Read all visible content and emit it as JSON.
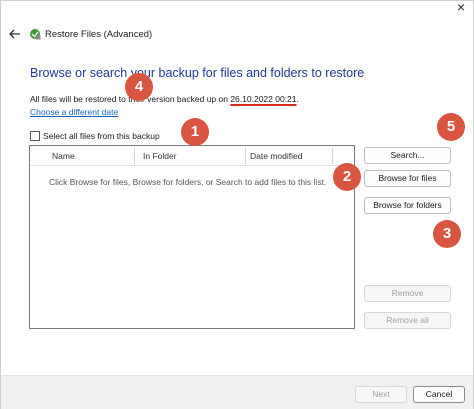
{
  "window": {
    "title": "Restore Files (Advanced)"
  },
  "heading": "Browse or search your backup for files and folders to restore",
  "restore_info": {
    "prefix": "All files will be restored to their version backed up on ",
    "date": "26.10.2022 00:21",
    "suffix": "."
  },
  "choose_link": "Choose a different date",
  "select_all_label": "Select all files from this backup",
  "select_all_checked": false,
  "grid": {
    "columns": [
      "Name",
      "In Folder",
      "Date modified"
    ],
    "empty_hint": "Click Browse for files, Browse for folders, or Search to add files to this list."
  },
  "buttons": {
    "search": "Search...",
    "browse_files": "Browse for files",
    "browse_folders": "Browse for folders",
    "remove": "Remove",
    "remove_all": "Remove all",
    "next": "Next",
    "cancel": "Cancel"
  },
  "annotations": [
    "1",
    "2",
    "3",
    "4",
    "5"
  ],
  "colors": {
    "heading": "#1f3a93",
    "link": "#1565c0",
    "badge": "#d9553f",
    "date_underline": "#d9281e"
  }
}
